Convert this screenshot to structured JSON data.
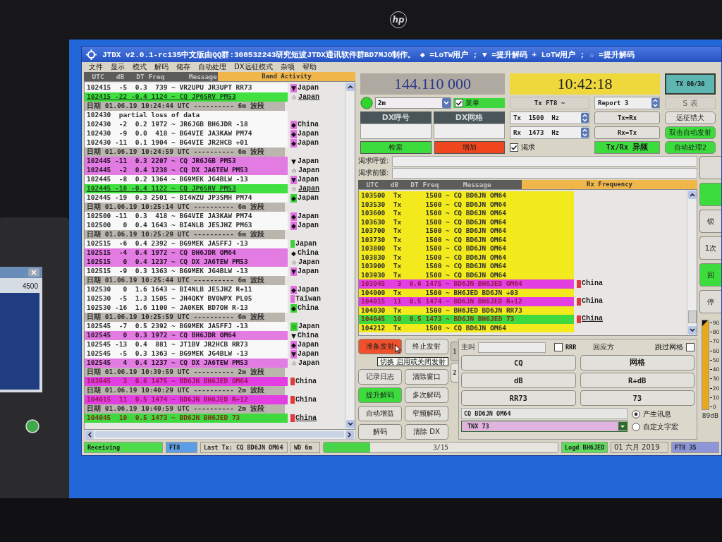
{
  "monitor": {
    "logo": "hp"
  },
  "side_screen": {
    "reading": "4500"
  },
  "window": {
    "title": "JTDX  v2.0.1-rc135中文版由QQ群:308532243研究短波JTDX通讯软件群BD7MJO制作。 ◆ =LoTW用户 ; ▼ =提升解码 + LoTW用户 ; ☆ =提升解码"
  },
  "menu": [
    "文件",
    "显示",
    "模式",
    "解码",
    "储存",
    "自动处理",
    "DX远征模式",
    "杂项",
    "帮助"
  ],
  "band_activity": {
    "header": "  UTC   dB   DT Freq      Message",
    "title": "Band Activity",
    "rows": [
      {
        "kind": "decode",
        "text": "102415  -5  0.3  739 ~ VR2UPU JR3UPT RR73",
        "marker": "▼",
        "color": "#e070e0",
        "country": "Japan"
      },
      {
        "kind": "new",
        "text": "102415 -22 -0.4 1124 ~ CQ JP6SRV PM53",
        "marker": "☆",
        "country": "Japan"
      },
      {
        "kind": "separator",
        "text": "日期 01.06.19 10:24:44 UTC ---------- 6m 波段"
      },
      {
        "kind": "decode",
        "text": "102430  partial loss of data"
      },
      {
        "kind": "decode",
        "text": "102430  -2  0.2 1972 ~ JR6JGB BH6JDR -18",
        "marker": "◆",
        "color": "#e070e0",
        "country": "China"
      },
      {
        "kind": "decode",
        "text": "102430  -9  0.0  418 ~ BG4VIE JA3KAW PM74",
        "marker": "◆",
        "color": "#e070e0",
        "country": "Japan"
      },
      {
        "kind": "decode",
        "text": "102430 -11  0.1 1904 ~ BG4VIE JR2HCB +01",
        "marker": "◆",
        "color": "#e070e0",
        "country": "Japan"
      },
      {
        "kind": "separator",
        "text": "日期 01.06.19 10:24:59 UTC ---------- 6m 波段"
      },
      {
        "kind": "cq",
        "text": "102445 -11  0.3 2207 ~ CQ JR6JGB PM53",
        "marker": "▼",
        "country": "Japan"
      },
      {
        "kind": "cq",
        "text": "102445  -2  0.4 1238 ~ CQ DX JA6TEW PM53",
        "marker": "☆",
        "country": "Japan"
      },
      {
        "kind": "decode",
        "text": "102445  -8  0.2 1364 ~ BG9MEK JG4BLW -13",
        "marker": "▼",
        "color": "#e070e0",
        "country": "Japan"
      },
      {
        "kind": "new",
        "text": "102445 -18 -0.4 1122 ~ CQ JP6SRV PM53",
        "marker": "☆",
        "country": "Japan"
      },
      {
        "kind": "decode",
        "text": "102445 -19  0.3 2501 ~ BI4WZU JP3SMH PM74",
        "marker": "◆",
        "color": "#3cd03c",
        "country": "Japan"
      },
      {
        "kind": "separator",
        "text": "日期 01.06.19 10:25:14 UTC ---------- 6m 波段"
      },
      {
        "kind": "decode",
        "text": "102500 -11  0.3  418 ~ BG4VIE JA3KAW PM74",
        "marker": "◆",
        "color": "#e070e0",
        "country": "Japan"
      },
      {
        "kind": "decode",
        "text": "102500   0  0.4 1643 ~ BI4NLB JE5JHZ PM63",
        "marker": "◆",
        "color": "#e070e0",
        "country": "Japan"
      },
      {
        "kind": "separator",
        "text": "日期 01.06.19 10:25:29 UTC ---------- 6m 波段"
      },
      {
        "kind": "decode",
        "text": "102515  -6  0.4 2392 ~ BG9MEK JA5FFJ -13",
        "color": "#3cd03c",
        "country": "Japan"
      },
      {
        "kind": "cq",
        "text": "102515  -4  0.4 1972 ~ CQ BH6JDR OM64",
        "marker": "◆",
        "country": "China"
      },
      {
        "kind": "cq",
        "text": "102515   0  0.4 1237 ~ CQ DX JA6TEW PM53",
        "marker": "☆",
        "country": "Japan"
      },
      {
        "kind": "decode",
        "text": "102515  -9  0.3 1363 ~ BG9MEK JG4BLW -13",
        "marker": "▼",
        "color": "#e070e0",
        "country": "Japan"
      },
      {
        "kind": "separator",
        "text": "日期 01.06.19 10:25:44 UTC ---------- 6m 波段"
      },
      {
        "kind": "decode",
        "text": "102530   0  1.6 1643 ~ BI4NLB JE5JHZ R+11",
        "marker": "◆",
        "color": "#e070e0",
        "country": "Japan"
      },
      {
        "kind": "decode",
        "text": "102530  -5  1.3 1505 ~ JH4QKY BV0WPX PL05",
        "color": "#e070e0",
        "country": "Taiwan"
      },
      {
        "kind": "decode",
        "text": "102530 -16  1.6 1100 ~ JA0KEK BD7OH R-13",
        "marker": "◆",
        "color": "#3cd03c",
        "country": "China"
      },
      {
        "kind": "separator",
        "text": "日期 01.06.19 10:25:59 UTC ---------- 6m 波段"
      },
      {
        "kind": "decode",
        "text": "102545  -7  0.5 2392 ~ BG9MEK JA5FFJ -13",
        "marker": "☆",
        "color": "#3cd03c",
        "country": "Japan"
      },
      {
        "kind": "cq",
        "text": "102545   0  0.3 1972 ~ CQ BH6JDR OM64",
        "marker": "▼",
        "country": "China"
      },
      {
        "kind": "decode",
        "text": "102545 -13  0.4  881 ~ JT1BV JR2HCB RR73",
        "marker": "◆",
        "color": "#e070e0",
        "country": "Japan"
      },
      {
        "kind": "decode",
        "text": "102545  -5  0.3 1363 ~ BG9MEK JG4BLW -13",
        "marker": "▼",
        "color": "#e070e0",
        "country": "Japan"
      },
      {
        "kind": "cq",
        "text": "102545   4  0.4 1237 ~ CQ DX JA6TEW PM53",
        "marker": "☆",
        "country": "Japan"
      },
      {
        "kind": "separator",
        "text": "日期 01.06.19 10:39:59 UTC ---------- 2m 波段"
      },
      {
        "kind": "mine",
        "text": "103945   3  0.6 1475 ~ BD6JN BH6JED OM64",
        "color": "#e03a3a",
        "country": "China"
      },
      {
        "kind": "separator",
        "text": "日期 01.06.19 10:40:29 UTC ---------- 2m 波段"
      },
      {
        "kind": "mine",
        "text": "104015  11  0.5 1474 ~ BD6JN BH6JED R+12",
        "color": "#e03a3a",
        "country": "China"
      },
      {
        "kind": "separator",
        "text": "日期 01.06.19 10:40:59 UTC ---------- 2m 波段"
      },
      {
        "kind": "done",
        "text": "104045  10  0.5 1473 ~ BD6JN BH6JED 73",
        "color": "#e03a3a",
        "country": "China"
      }
    ]
  },
  "station": {
    "frequency": "144.110 000",
    "clock": "10:42:18",
    "tx_counter": "TX 00/30",
    "band": "2m",
    "menu_toggle": {
      "label": "菜单",
      "checked": true
    },
    "mode_button": {
      "label": "Tx FT8 ~"
    },
    "report": "Report 3",
    "s_meter": {
      "label": "S 表",
      "disabled": true
    },
    "dx_call": {
      "label": "DX呼号"
    },
    "dx_grid": {
      "label": "DX网格"
    },
    "tx_freq": "Tx  1500  Hz",
    "rx_freq": "Rx  1473  Hz",
    "tx_eq_rx": {
      "label": "Tx=Rx"
    },
    "hound": {
      "label": "远征猎犬"
    },
    "rx_eq_tx": {
      "label": "Rx=Tx"
    },
    "auto_tx": {
      "label": "双击自动发射",
      "color": "#3cdc3c"
    },
    "lookup": {
      "label": "检索",
      "color": "#3cdc3c"
    },
    "add": {
      "label": "增加",
      "color": "#f0461e"
    },
    "wanted_toggle": {
      "label": "渴求",
      "checked": true
    },
    "split": {
      "label": "Tx/Rx 异频",
      "color": "#3cdc3c"
    },
    "auto_seq": {
      "label": "自动处理2",
      "color": "#3cdc3c"
    },
    "wanted_fields": [
      {
        "label": "渴求呼號:"
      },
      {
        "label": "渴求前辍:"
      }
    ]
  },
  "rx_frequency": {
    "header": "  UTC   dB   DT Freq      Message",
    "title": "Rx Frequency",
    "rows": [
      {
        "kind": "tx",
        "text": "103500  Tx      1500 ~ CQ BD6JN OM64"
      },
      {
        "kind": "tx",
        "text": "103530  Tx      1500 ~ CQ BD6JN OM64"
      },
      {
        "kind": "tx",
        "text": "103600  Tx      1500 ~ CQ BD6JN OM64"
      },
      {
        "kind": "tx",
        "text": "103630  Tx      1500 ~ CQ BD6JN OM64"
      },
      {
        "kind": "tx",
        "text": "103700  Tx      1500 ~ CQ BD6JN OM64"
      },
      {
        "kind": "tx",
        "text": "103730  Tx      1500 ~ CQ BD6JN OM64"
      },
      {
        "kind": "tx",
        "text": "103800  Tx      1500 ~ CQ BD6JN OM64"
      },
      {
        "kind": "tx",
        "text": "103830  Tx      1500 ~ CQ BD6JN OM64"
      },
      {
        "kind": "tx",
        "text": "103900  Tx      1500 ~ CQ BD6JN OM64"
      },
      {
        "kind": "tx",
        "text": "103930  Tx      1500 ~ CQ BD6JN OM64"
      },
      {
        "kind": "mine",
        "text": "103945   3  0.6 1475 ~ BD6JN BH6JED OM64",
        "color": "#e03a3a",
        "country": "China"
      },
      {
        "kind": "tx",
        "text": "104000  Tx      1500 ~ BH6JED BD6JN +03"
      },
      {
        "kind": "mine",
        "text": "104015  11  0.5 1474 ~ BD6JN BH6JED R+12",
        "color": "#e03a3a",
        "country": "China"
      },
      {
        "kind": "tx",
        "text": "104030  Tx      1500 ~ BH6JED BD6JN RR73"
      },
      {
        "kind": "done",
        "text": "104045  10  0.5 1473 ~ BD6JN BH6JED 73",
        "color": "#e03a3a",
        "country": "China"
      },
      {
        "kind": "tx",
        "text": "104212  Tx      1500 ~ CQ BD6JN OM64"
      }
    ]
  },
  "tx_buttons": [
    {
      "label": "准备发射",
      "color": "#f0502c"
    },
    {
      "label": "终止发射"
    },
    {
      "label": "记录日志"
    },
    {
      "label": "清除窗口"
    },
    {
      "label": "提升解码",
      "color": "#3cdc3c"
    },
    {
      "label": "多次解码"
    },
    {
      "label": "自动增益"
    },
    {
      "label": "窄频解码"
    },
    {
      "label": "解码"
    },
    {
      "label": "清除 DX"
    }
  ],
  "tooltip": "切换 启用或关闭发射",
  "messages": {
    "tabs": [
      {
        "label": "1",
        "selected": false
      },
      {
        "label": "2",
        "selected": true
      }
    ],
    "caller_label": "主叫",
    "rrr": {
      "label": "RRR",
      "checked": false
    },
    "responder_label": "回应方",
    "skip_grid": {
      "label": "跳过网格",
      "checked": false
    },
    "buttons": [
      "CQ",
      "网格",
      "dB",
      "R+dB",
      "RR73",
      "73"
    ],
    "current": "CQ BD6JN OM64",
    "free_text": "TNX 73",
    "options": [
      {
        "label": "产生讯息",
        "selected": true
      },
      {
        "label": "自定文字宏",
        "selected": false
      }
    ]
  },
  "side_buttons": [
    {
      "color": "#dedcd6"
    },
    {
      "color": "#3cdc3c"
    },
    {
      "label": "锁",
      "color": "#dedcd6"
    },
    {
      "label": "1次",
      "color": "#dedcd6"
    },
    {
      "label": "回",
      "color": "#3cdc3c"
    },
    {
      "label": "停",
      "color": "#dedcd6"
    }
  ],
  "meter": {
    "level": 0.99,
    "ticks": [
      "90",
      "80",
      "70",
      "60",
      "50",
      "40",
      "30",
      "20",
      "10",
      "0"
    ],
    "reading": "89dB"
  },
  "status_bar": {
    "state": {
      "text": "Receiving",
      "color": "#4cdc4c"
    },
    "mode": {
      "text": "FT8",
      "color": "#5b9ee6"
    },
    "last_tx": "Last Tx: CQ BD6JN OM64",
    "watchdog": "WD 6m",
    "progress": {
      "label": "3/15",
      "level": 0.2
    },
    "logged": {
      "text": "Logd BH6JED",
      "color": "#5cdc5c"
    },
    "date": "01 六月 2019",
    "period": {
      "text": "FT8  3S",
      "color": "#8c96d8"
    }
  }
}
